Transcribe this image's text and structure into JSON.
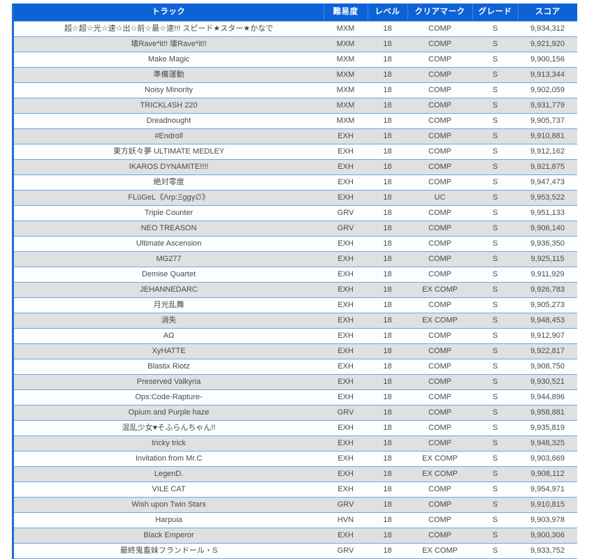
{
  "table": {
    "columns": [
      {
        "key": "track",
        "label": "トラック"
      },
      {
        "key": "diff",
        "label": "難易度"
      },
      {
        "key": "level",
        "label": "レベル"
      },
      {
        "key": "mark",
        "label": "クリアマーク"
      },
      {
        "key": "grade",
        "label": "グレード"
      },
      {
        "key": "score",
        "label": "スコア"
      }
    ],
    "colors": {
      "header_bg": "#0d62d6",
      "border": "#1f6fd0",
      "row_even_bg": "#fdfdfd",
      "row_odd_bg": "#e0e0e0",
      "row_line": "#6fa4e8",
      "diff_MXM": "#6e6e6e",
      "diff_EXH": "#f4697f",
      "diff_GRV": "#f2a63c",
      "diff_HVN": "#4c9ae8",
      "mark_COMP": "#6ed6a6",
      "mark_EX_COMP": "#d26ae8",
      "mark_UC": "#f4697f"
    },
    "rows": [
      {
        "track": "超☆超☆光☆速☆出☆前☆最☆速!!! スピード★スター★かなで",
        "diff": "MXM",
        "level": "18",
        "mark": "COMP",
        "grade": "S",
        "score": "9,934,312"
      },
      {
        "track": "壊Rave*it!! 壊Rave*it!!",
        "diff": "MXM",
        "level": "18",
        "mark": "COMP",
        "grade": "S",
        "score": "9,921,920"
      },
      {
        "track": "Make Magic",
        "diff": "MXM",
        "level": "18",
        "mark": "COMP",
        "grade": "S",
        "score": "9,900,156"
      },
      {
        "track": "準備運動",
        "diff": "MXM",
        "level": "18",
        "mark": "COMP",
        "grade": "S",
        "score": "9,913,344"
      },
      {
        "track": "Noisy Minority",
        "diff": "MXM",
        "level": "18",
        "mark": "COMP",
        "grade": "S",
        "score": "9,902,059"
      },
      {
        "track": "TRICKL4SH 220",
        "diff": "MXM",
        "level": "18",
        "mark": "COMP",
        "grade": "S",
        "score": "9,931,779"
      },
      {
        "track": "Dreadnought",
        "diff": "MXM",
        "level": "18",
        "mark": "COMP",
        "grade": "S",
        "score": "9,905,737"
      },
      {
        "track": "#Endroll",
        "diff": "EXH",
        "level": "18",
        "mark": "COMP",
        "grade": "S",
        "score": "9,910,881"
      },
      {
        "track": "東方妖々夢 ULTIMATE MEDLEY",
        "diff": "EXH",
        "level": "18",
        "mark": "COMP",
        "grade": "S",
        "score": "9,912,162"
      },
      {
        "track": "IKAROS DYNAMITE!!!!",
        "diff": "EXH",
        "level": "18",
        "mark": "COMP",
        "grade": "S",
        "score": "9,921,875"
      },
      {
        "track": "絶対零度",
        "diff": "EXH",
        "level": "18",
        "mark": "COMP",
        "grade": "S",
        "score": "9,947,473"
      },
      {
        "track": "FLüGeL《Λrp:Ξggγ∅》",
        "diff": "EXH",
        "level": "18",
        "mark": "UC",
        "grade": "S",
        "score": "9,953,522"
      },
      {
        "track": "Triple Counter",
        "diff": "GRV",
        "level": "18",
        "mark": "COMP",
        "grade": "S",
        "score": "9,951,133"
      },
      {
        "track": "NEO TREASON",
        "diff": "GRV",
        "level": "18",
        "mark": "COMP",
        "grade": "S",
        "score": "9,906,140"
      },
      {
        "track": "Ultimate Ascension",
        "diff": "EXH",
        "level": "18",
        "mark": "COMP",
        "grade": "S",
        "score": "9,936,350"
      },
      {
        "track": "MG277",
        "diff": "EXH",
        "level": "18",
        "mark": "COMP",
        "grade": "S",
        "score": "9,925,115"
      },
      {
        "track": "Demise Quartet",
        "diff": "EXH",
        "level": "18",
        "mark": "COMP",
        "grade": "S",
        "score": "9,911,929"
      },
      {
        "track": "JEHANNEDARC",
        "diff": "EXH",
        "level": "18",
        "mark": "EX COMP",
        "grade": "S",
        "score": "9,926,783"
      },
      {
        "track": "月光乱舞",
        "diff": "EXH",
        "level": "18",
        "mark": "COMP",
        "grade": "S",
        "score": "9,905,273"
      },
      {
        "track": "消失",
        "diff": "EXH",
        "level": "18",
        "mark": "EX COMP",
        "grade": "S",
        "score": "9,948,453"
      },
      {
        "track": "AΩ",
        "diff": "EXH",
        "level": "18",
        "mark": "COMP",
        "grade": "S",
        "score": "9,912,907"
      },
      {
        "track": "XyHATTE",
        "diff": "EXH",
        "level": "18",
        "mark": "COMP",
        "grade": "S",
        "score": "9,922,817"
      },
      {
        "track": "Blastix Riotz",
        "diff": "EXH",
        "level": "18",
        "mark": "COMP",
        "grade": "S",
        "score": "9,908,750"
      },
      {
        "track": "Preserved Valkyria",
        "diff": "EXH",
        "level": "18",
        "mark": "COMP",
        "grade": "S",
        "score": "9,930,521"
      },
      {
        "track": "Ops:Code-Rapture-",
        "diff": "EXH",
        "level": "18",
        "mark": "COMP",
        "grade": "S",
        "score": "9,944,896"
      },
      {
        "track": "Opium and Purple haze",
        "diff": "GRV",
        "level": "18",
        "mark": "COMP",
        "grade": "S",
        "score": "9,958,881"
      },
      {
        "track": "混乱少女♥そふらんちゃん!!",
        "diff": "EXH",
        "level": "18",
        "mark": "COMP",
        "grade": "S",
        "score": "9,935,819"
      },
      {
        "track": "tricky trick",
        "diff": "EXH",
        "level": "18",
        "mark": "COMP",
        "grade": "S",
        "score": "9,948,325"
      },
      {
        "track": "Invitation from Mr.C",
        "diff": "EXH",
        "level": "18",
        "mark": "EX COMP",
        "grade": "S",
        "score": "9,903,669"
      },
      {
        "track": "LegenD.",
        "diff": "EXH",
        "level": "18",
        "mark": "EX COMP",
        "grade": "S",
        "score": "9,908,112"
      },
      {
        "track": "VILE CAT",
        "diff": "EXH",
        "level": "18",
        "mark": "COMP",
        "grade": "S",
        "score": "9,954,971"
      },
      {
        "track": "Wish upon Twin Stars",
        "diff": "GRV",
        "level": "18",
        "mark": "COMP",
        "grade": "S",
        "score": "9,910,815"
      },
      {
        "track": "Harpuia",
        "diff": "HVN",
        "level": "18",
        "mark": "COMP",
        "grade": "S",
        "score": "9,903,978"
      },
      {
        "track": "Black Emperor",
        "diff": "EXH",
        "level": "18",
        "mark": "COMP",
        "grade": "S",
        "score": "9,900,306"
      },
      {
        "track": "最終鬼畜妹フランドール・S",
        "diff": "GRV",
        "level": "18",
        "mark": "EX COMP",
        "grade": "S",
        "score": "9,933,752"
      }
    ]
  }
}
